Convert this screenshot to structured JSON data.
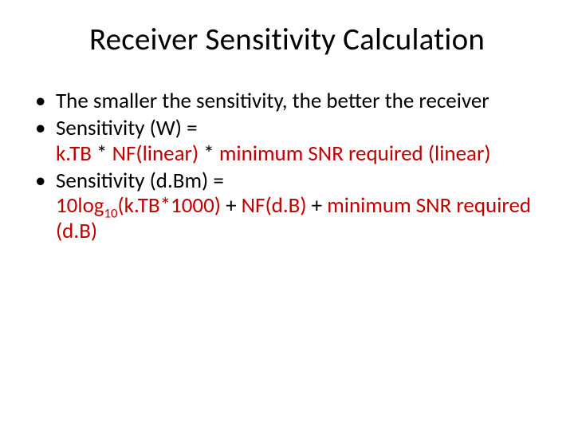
{
  "title": "Receiver Sensitivity Calculation",
  "b1": "The smaller the sensitivity, the better the receiver",
  "b2": {
    "pre": "Sensitivity (W) = ",
    "red1": "k.TB",
    "mid1": " * ",
    "red2": "NF(linear)",
    "mid2": " * ",
    "red3": "minimum SNR required (linear)"
  },
  "b3": {
    "pre": "Sensitivity (d.Bm) = ",
    "red1a": "10log",
    "red1sub": "10",
    "red1b": "(k.TB*1000)",
    "mid1": " + ",
    "red2": "NF(d.B)",
    "mid2": " + ",
    "red3": "minimum SNR required (d.B)"
  }
}
